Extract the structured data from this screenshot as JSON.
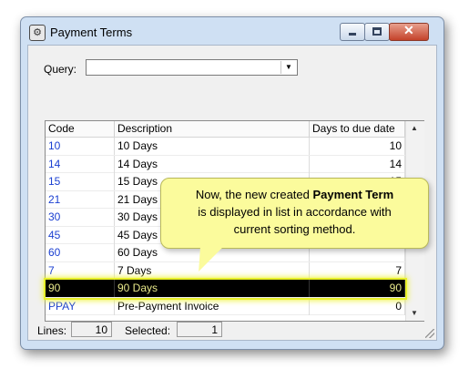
{
  "window": {
    "title": "Payment Terms",
    "icon": "payment-terms-app-icon",
    "controls": {
      "minimize": "minimize-icon",
      "maximize": "maximize-icon",
      "close": "close-icon"
    }
  },
  "query": {
    "label": "Query:",
    "value": "",
    "arrow": "▼"
  },
  "list": {
    "columns": [
      "Code",
      "Description",
      "Days to due date"
    ],
    "rows": [
      {
        "code": "10",
        "description": "10 Days",
        "days": "10"
      },
      {
        "code": "14",
        "description": "14 Days",
        "days": "14"
      },
      {
        "code": "15",
        "description": "15 Days",
        "days": "15"
      },
      {
        "code": "21",
        "description": "21 Days",
        "days": ""
      },
      {
        "code": "30",
        "description": "30 Days",
        "days": ""
      },
      {
        "code": "45",
        "description": "45 Days",
        "days": ""
      },
      {
        "code": "60",
        "description": "60 Days",
        "days": ""
      },
      {
        "code": "7",
        "description": "7 Days",
        "days": "7"
      },
      {
        "code": "90",
        "description": "90 Days",
        "days": "90",
        "selected": true
      },
      {
        "code": "PPAY",
        "description": "Pre-Payment Invoice",
        "days": "0"
      }
    ]
  },
  "status": {
    "lines_label": "Lines:",
    "lines_value": "10",
    "selected_label": "Selected:",
    "selected_value": "1"
  },
  "callout": {
    "part1": "Now, the new created ",
    "bold": "Payment Term",
    "part2": "is displayed in list in accordance with",
    "part3": "current sorting method."
  },
  "colors": {
    "code_text": "#1a3fd1",
    "selection_bg": "#000000",
    "selection_glow": "#eef34a",
    "callout_bg": "#fbfb9c"
  }
}
